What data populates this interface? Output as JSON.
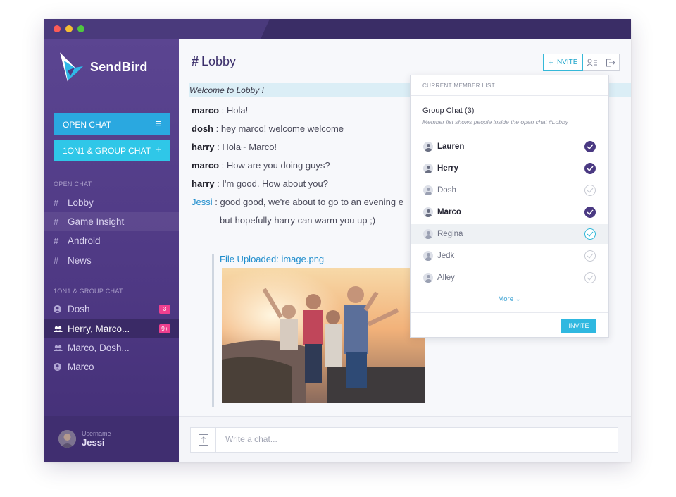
{
  "app": {
    "name": "SendBird"
  },
  "colors": {
    "sidebar": "#4e3883",
    "accent": "#2aa8e0",
    "badge": "#ef3f8f",
    "check": "#4a3982"
  },
  "sidebar": {
    "open_chat_button": "OPEN CHAT",
    "group_chat_button": "1ON1 & GROUP CHAT",
    "open_chat_section": "OPEN CHAT",
    "channels": [
      {
        "label": "Lobby"
      },
      {
        "label": "Game Insight"
      },
      {
        "label": "Android"
      },
      {
        "label": "News"
      }
    ],
    "group_section": "1ON1 & GROUP CHAT",
    "groups": [
      {
        "label": "Dosh",
        "badge": "3",
        "icon": "user-icon"
      },
      {
        "label": "Herry, Marco...",
        "badge": "9+",
        "icon": "group-icon"
      },
      {
        "label": "Marco, Dosh...",
        "badge": "",
        "icon": "group-icon"
      },
      {
        "label": "Marco",
        "badge": "",
        "icon": "user-icon"
      }
    ],
    "profile": {
      "label": "Username",
      "name": "Jessi"
    }
  },
  "main": {
    "channel_title": "Lobby",
    "invite_label": "INVITE",
    "welcome": "Welcome to Lobby !",
    "messages": [
      {
        "user": "marco",
        "text": " : Hola!"
      },
      {
        "user": "dosh",
        "text": " : hey marco! welcome welcome"
      },
      {
        "user": "harry",
        "text": " : Hola~ Marco!"
      },
      {
        "user": "marco",
        "text": " : How are you doing guys?"
      },
      {
        "user": "harry",
        "text": " : I'm good. How about you?"
      },
      {
        "user": "Jessi",
        "text": " : good good, we're about to go to an evening e"
      }
    ],
    "continuation": "but hopefully harry can warm you up ;)",
    "file_upload": "File Uploaded: image.png",
    "composer_placeholder": "Write a chat..."
  },
  "member_panel": {
    "header": "CURRENT MEMBER LIST",
    "group_title": "Group Chat (3)",
    "subtitle": "Member list shows people inside the open chat #Lobby",
    "members": [
      {
        "name": "Lauren",
        "state": "on"
      },
      {
        "name": "Herry",
        "state": "on"
      },
      {
        "name": "Dosh",
        "state": "off"
      },
      {
        "name": "Marco",
        "state": "on"
      },
      {
        "name": "Regina",
        "state": "sel"
      },
      {
        "name": "Jedk",
        "state": "off"
      },
      {
        "name": "Alley",
        "state": "off"
      }
    ],
    "more_label": "More",
    "invite_button": "INVITE"
  }
}
